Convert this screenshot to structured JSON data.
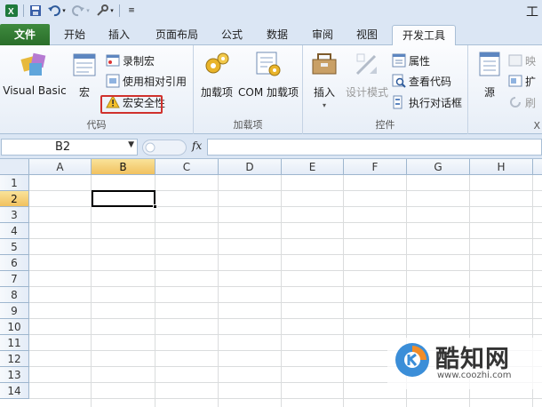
{
  "window": {
    "title_fragment": "工"
  },
  "quick_access": {
    "icons": [
      "excel-app-icon",
      "save-icon",
      "undo-icon",
      "redo-icon",
      "customize-icon"
    ]
  },
  "tabs": [
    {
      "label": "文件",
      "name": "tab-file"
    },
    {
      "label": "开始",
      "name": "tab-home"
    },
    {
      "label": "插入",
      "name": "tab-insert"
    },
    {
      "label": "页面布局",
      "name": "tab-page-layout"
    },
    {
      "label": "公式",
      "name": "tab-formulas"
    },
    {
      "label": "数据",
      "name": "tab-data"
    },
    {
      "label": "审阅",
      "name": "tab-review"
    },
    {
      "label": "视图",
      "name": "tab-view"
    },
    {
      "label": "开发工具",
      "name": "tab-developer",
      "active": true
    }
  ],
  "ribbon": {
    "code_group": {
      "label": "代码",
      "visual_basic": "Visual Basic",
      "macros": "宏",
      "record_macro": "录制宏",
      "use_relative": "使用相对引用",
      "macro_security": "宏安全性"
    },
    "addins_group": {
      "label": "加载项",
      "addins": "加载项",
      "com_addins": "COM 加载项"
    },
    "controls_group": {
      "label": "控件",
      "insert": "插入",
      "design_mode": "设计模式",
      "properties": "属性",
      "view_code": "查看代码",
      "run_dialog": "执行对话框"
    },
    "xml_group": {
      "source": "源",
      "label_fragment": "X",
      "map_props": "映",
      "expansion": "扩",
      "refresh": "刷"
    }
  },
  "formula_bar": {
    "name_box": "B2",
    "fx_label": "fx",
    "formula": ""
  },
  "sheet": {
    "columns": [
      "A",
      "B",
      "C",
      "D",
      "E",
      "F",
      "G",
      "H"
    ],
    "rows": [
      "1",
      "2",
      "3",
      "4",
      "5",
      "6",
      "7",
      "8",
      "9",
      "10",
      "11",
      "12",
      "13",
      "14"
    ],
    "selected_column": "B",
    "selected_row": "2",
    "active_cell": "B2"
  },
  "watermark": {
    "brand": "酷知网",
    "url": "www.coozhi.com"
  },
  "colors": {
    "tab_file_green": "#2a6e2a",
    "highlight_red": "#d0312d",
    "selection_gold": "#f1c15f"
  }
}
